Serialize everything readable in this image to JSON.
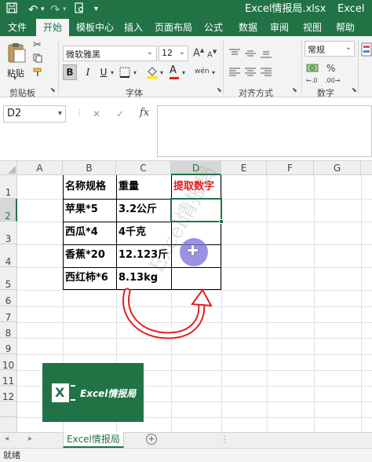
{
  "window": {
    "title": "Excel情报局.xlsx",
    "app_name": "Excel",
    "undo": "↶",
    "redo": "↷"
  },
  "ribbon_tabs": [
    "文件",
    "开始",
    "模板中心",
    "插入",
    "页面布局",
    "公式",
    "数据",
    "审阅",
    "视图",
    "帮助"
  ],
  "active_tab": "开始",
  "ribbon": {
    "paste_label": "粘贴",
    "clipboard_label": "剪贴板",
    "font_name": "微软雅黑",
    "font_size": "12",
    "font_label": "字体",
    "bold": "B",
    "italic": "I",
    "underline": "U",
    "phonetic": "wén",
    "align_label": "对齐方式",
    "number_format": "常规",
    "number_label": "数字",
    "font_grow": "A",
    "font_shrink": "A",
    "font_color_glyph": "A"
  },
  "formula_bar": {
    "name_box": "D2",
    "fx": "fx",
    "formula": ""
  },
  "sheet": {
    "columns": [
      "A",
      "B",
      "C",
      "D",
      "E",
      "F",
      "G"
    ],
    "rows": [
      "1",
      "2",
      "3",
      "4",
      "5",
      "6",
      "7",
      "8",
      "9",
      "10",
      "11",
      "12"
    ],
    "table": {
      "headers": [
        "名称规格",
        "重量",
        "提取数字"
      ],
      "rows": [
        [
          "苹果*5",
          "3.2公斤",
          ""
        ],
        [
          "西瓜*4",
          "4千克",
          ""
        ],
        [
          "香蕉*20",
          "12.123斤",
          ""
        ],
        [
          "西红柿*6",
          "8.13kg",
          ""
        ]
      ]
    },
    "logo_text": "Excel情报局",
    "logo_letter": "X",
    "watermark": "Excel情报局",
    "accent_red": "#e02020",
    "cursor_glyph": "✚"
  },
  "sheet_tabs": [
    "Excel情报局"
  ],
  "status": "就绪"
}
